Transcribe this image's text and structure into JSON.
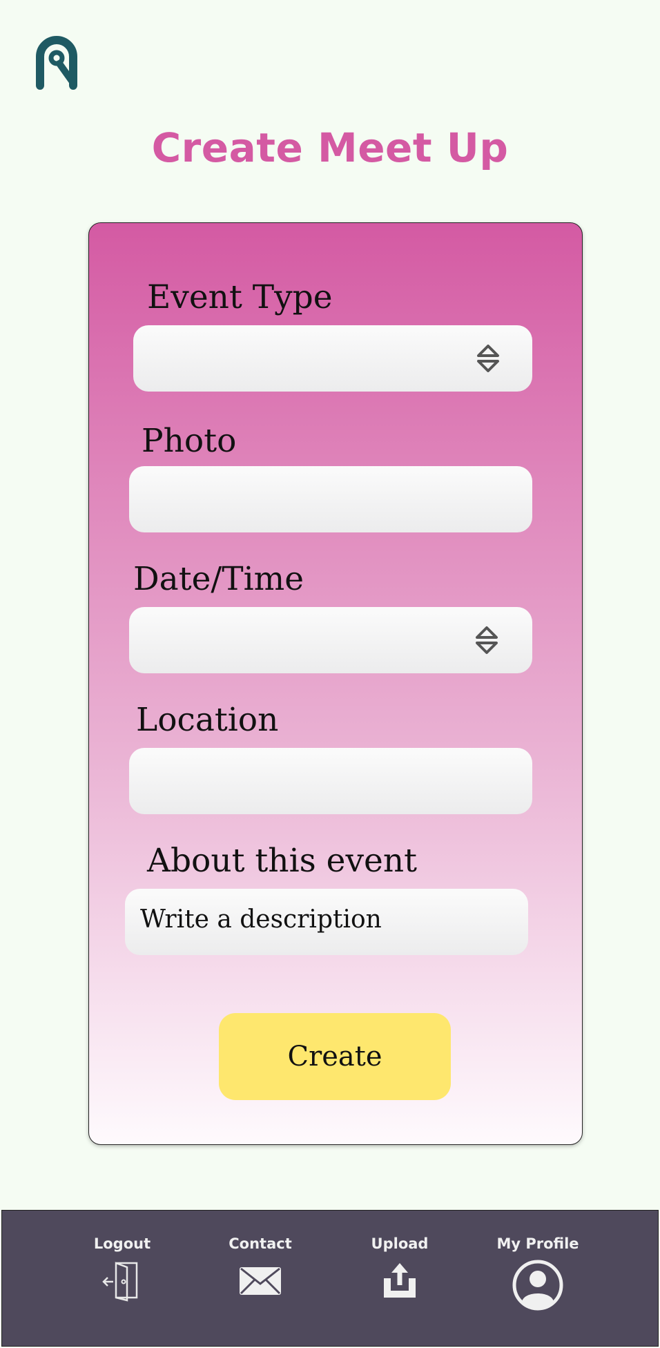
{
  "header": {
    "title": "Create Meet Up",
    "logo_icon": "brand-logo-icon",
    "logo_color": "#1f5a63",
    "title_color": "#d45aa3"
  },
  "form": {
    "event_type": {
      "label": "Event Type",
      "value": "",
      "icon": "stepper-icon"
    },
    "photo": {
      "label": "Photo",
      "value": ""
    },
    "date_time": {
      "label": "Date/Time",
      "value": "",
      "icon": "stepper-icon"
    },
    "location": {
      "label": "Location",
      "value": ""
    },
    "about": {
      "label": "About this event",
      "placeholder": "Write a description"
    },
    "create_label": "Create",
    "create_color": "#fee76e"
  },
  "nav": {
    "background": "#4f495c",
    "items": [
      {
        "label": "Logout",
        "icon": "logout-door-icon"
      },
      {
        "label": "Contact",
        "icon": "envelope-icon"
      },
      {
        "label": "Upload",
        "icon": "upload-icon"
      },
      {
        "label": "My Profile",
        "icon": "profile-icon"
      }
    ]
  }
}
